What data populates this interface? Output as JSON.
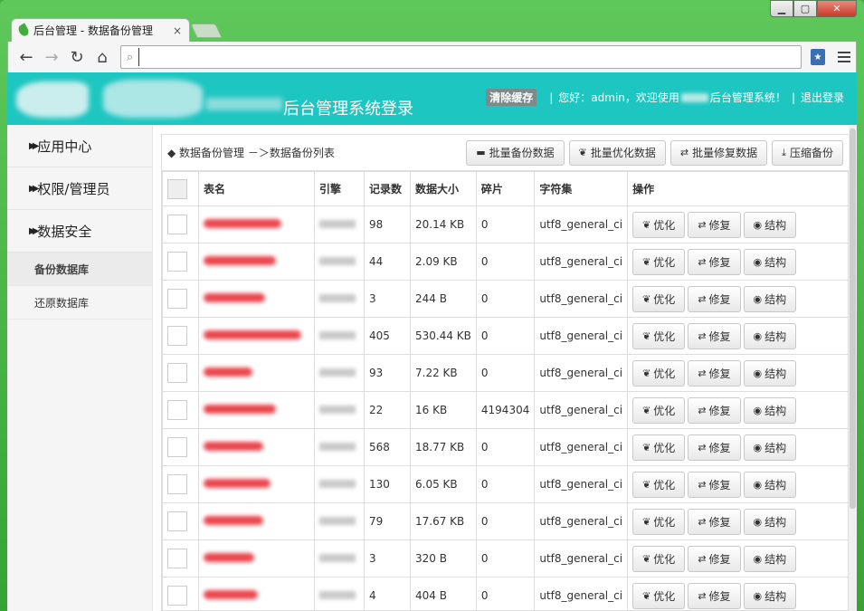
{
  "browser": {
    "tab_title": "后台管理 - 数据备份管理",
    "tab_close": "×",
    "url_value": "",
    "window_buttons": [
      "minimize",
      "maximize",
      "close"
    ]
  },
  "header": {
    "system_title": "后台管理系统登录",
    "clear_cache": "清除缓存",
    "greeting_prefix": "您好：",
    "username": "admin",
    "welcome_prefix": "，欢迎使用",
    "welcome_suffix": "后台管理系统！",
    "logout": "退出登录"
  },
  "sidebar": {
    "groups": [
      {
        "label": "应用中心"
      },
      {
        "label": "权限/管理员"
      },
      {
        "label": "数据安全"
      }
    ],
    "subitems": [
      {
        "label": "备份数据库",
        "active": true
      },
      {
        "label": "还原数据库",
        "active": false
      }
    ]
  },
  "content": {
    "breadcrumb": "◆ 数据备份管理 －＞数据备份列表",
    "actions": [
      {
        "label": "批量备份数据",
        "icon": "hdd-icon"
      },
      {
        "label": "批量优化数据",
        "icon": "leaf-icon"
      },
      {
        "label": "批量修复数据",
        "icon": "retweet-icon"
      },
      {
        "label": "压缩备份",
        "icon": "download-icon"
      }
    ],
    "columns": [
      "表名",
      "引擎",
      "记录数",
      "数据大小",
      "碎片",
      "字符集",
      "操作"
    ],
    "row_ops": [
      "优化",
      "修复",
      "结构"
    ],
    "rows": [
      {
        "records": "98",
        "size": "20.14 KB",
        "frag": "0",
        "charset": "utf8_general_ci"
      },
      {
        "records": "44",
        "size": "2.09 KB",
        "frag": "0",
        "charset": "utf8_general_ci"
      },
      {
        "records": "3",
        "size": "244 B",
        "frag": "0",
        "charset": "utf8_general_ci"
      },
      {
        "records": "405",
        "size": "530.44 KB",
        "frag": "0",
        "charset": "utf8_general_ci"
      },
      {
        "records": "93",
        "size": "7.22 KB",
        "frag": "0",
        "charset": "utf8_general_ci"
      },
      {
        "records": "22",
        "size": "16 KB",
        "frag": "4194304",
        "charset": "utf8_general_ci"
      },
      {
        "records": "568",
        "size": "18.77 KB",
        "frag": "0",
        "charset": "utf8_general_ci"
      },
      {
        "records": "130",
        "size": "6.05 KB",
        "frag": "0",
        "charset": "utf8_general_ci"
      },
      {
        "records": "79",
        "size": "17.67 KB",
        "frag": "0",
        "charset": "utf8_general_ci"
      },
      {
        "records": "3",
        "size": "320 B",
        "frag": "0",
        "charset": "utf8_general_ci"
      },
      {
        "records": "4",
        "size": "404 B",
        "frag": "0",
        "charset": "utf8_general_ci"
      }
    ]
  },
  "colors": {
    "header_bg": "#1ec6c1",
    "window_frame": "#3fae3f",
    "redacted_name": "#e8313a"
  }
}
